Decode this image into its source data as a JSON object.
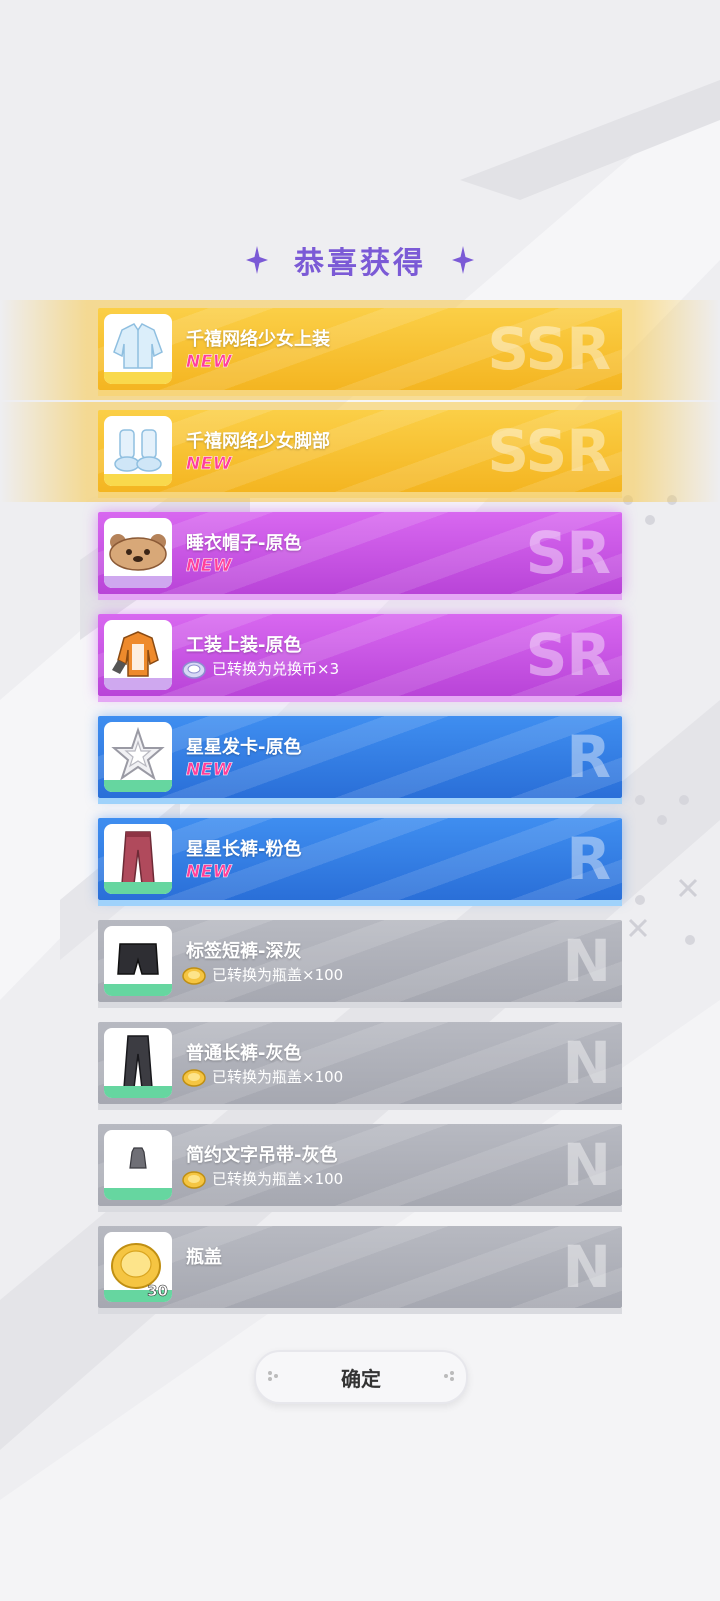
{
  "header": {
    "title": "恭喜获得"
  },
  "items": [
    {
      "name": "千禧网络少女上装",
      "rarity": "SSR",
      "status": "NEW",
      "icon": "jacket-icon"
    },
    {
      "name": "千禧网络少女脚部",
      "rarity": "SSR",
      "status": "NEW",
      "icon": "boots-icon"
    },
    {
      "name": "睡衣帽子-原色",
      "rarity": "SR",
      "status": "NEW",
      "icon": "bear-hat-icon"
    },
    {
      "name": "工装上装-原色",
      "rarity": "SR",
      "converted": "已转换为兑换币×3",
      "icon": "work-top-icon",
      "converted_icon": "token-icon"
    },
    {
      "name": "星星发卡-原色",
      "rarity": "R",
      "status": "NEW",
      "icon": "star-clip-icon"
    },
    {
      "name": "星星长裤-粉色",
      "rarity": "R",
      "status": "NEW",
      "icon": "pants-icon"
    },
    {
      "name": "标签短裤-深灰",
      "rarity": "N",
      "converted": "已转换为瓶盖×100",
      "icon": "shorts-icon",
      "converted_icon": "bottle-cap-icon"
    },
    {
      "name": "普通长裤-灰色",
      "rarity": "N",
      "converted": "已转换为瓶盖×100",
      "icon": "trousers-icon",
      "converted_icon": "bottle-cap-icon"
    },
    {
      "name": "简约文字吊带-灰色",
      "rarity": "N",
      "converted": "已转换为瓶盖×100",
      "icon": "tank-top-icon",
      "converted_icon": "bottle-cap-icon"
    },
    {
      "name": "瓶盖",
      "rarity": "N",
      "quantity": "30",
      "icon": "bottle-cap-icon"
    }
  ],
  "confirm_button": {
    "label": "确定"
  },
  "colors": {
    "ssr": "#f4b521",
    "sr": "#c152e2",
    "r": "#2f78e0",
    "n": "#acaeb6",
    "title": "#7b5ad6",
    "new_tag": "#ff3f9a"
  }
}
